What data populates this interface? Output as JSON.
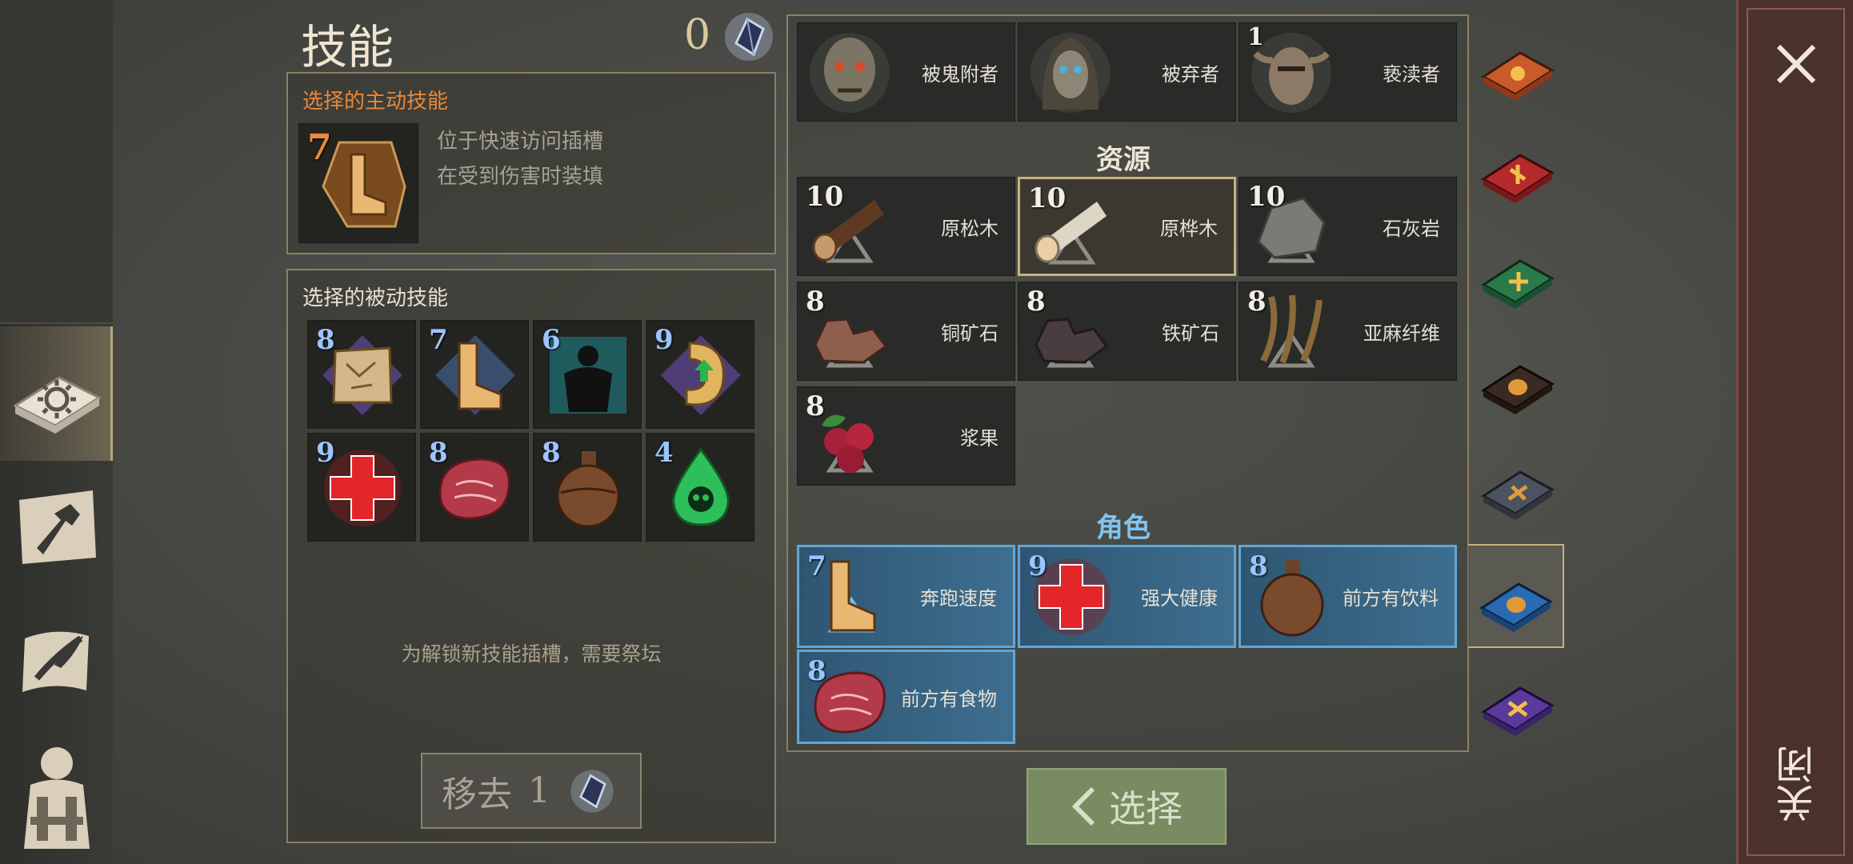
{
  "header": {
    "title": "技能",
    "currency_count": "0"
  },
  "active_skill": {
    "label": "选择的主动技能",
    "level": "7",
    "icon": "running-leg-icon",
    "desc_line1": "位于快速访问插槽",
    "desc_line2": "在受到伤害时装填"
  },
  "passive": {
    "label": "选择的被动技能",
    "slots": [
      {
        "level": "8",
        "icon": "map-scroll-icon"
      },
      {
        "level": "7",
        "icon": "running-leg-icon"
      },
      {
        "level": "6",
        "icon": "glowing-body-icon"
      },
      {
        "level": "9",
        "icon": "stomach-arrow-icon"
      },
      {
        "level": "9",
        "icon": "red-cross-icon"
      },
      {
        "level": "8",
        "icon": "steak-icon"
      },
      {
        "level": "8",
        "icon": "flask-icon"
      },
      {
        "level": "4",
        "icon": "poison-drop-icon"
      }
    ],
    "unlock_hint": "为解锁新技能插槽，需要祭坛",
    "remove_label": "移去",
    "remove_cost": "1"
  },
  "enemies": [
    {
      "name": "被鬼附者",
      "icon": "zombie-head-icon"
    },
    {
      "name": "被弃者",
      "icon": "hooded-ghoul-icon"
    },
    {
      "name": "亵渎者",
      "icon": "horned-skull-icon",
      "level": "1"
    }
  ],
  "resources": {
    "label": "资源",
    "items": [
      {
        "level": "10",
        "name": "原松木",
        "icon": "pine-log-icon"
      },
      {
        "level": "10",
        "name": "原桦木",
        "icon": "birch-log-icon"
      },
      {
        "level": "10",
        "name": "石灰岩",
        "icon": "limestone-icon"
      },
      {
        "level": "8",
        "name": "铜矿石",
        "icon": "copper-ore-icon"
      },
      {
        "level": "8",
        "name": "铁矿石",
        "icon": "iron-ore-icon"
      },
      {
        "level": "8",
        "name": "亚麻纤维",
        "icon": "flax-fiber-icon"
      },
      {
        "level": "8",
        "name": "浆果",
        "icon": "berries-icon"
      }
    ]
  },
  "character": {
    "label": "角色",
    "items": [
      {
        "level": "7",
        "name": "奔跑速度",
        "icon": "running-leg-icon"
      },
      {
        "level": "9",
        "name": "强大健康",
        "icon": "red-cross-icon"
      },
      {
        "level": "8",
        "name": "前方有饮料",
        "icon": "flask-icon"
      },
      {
        "level": "8",
        "name": "前方有食物",
        "icon": "steak-icon"
      }
    ]
  },
  "select_button": "选择",
  "close_label": "关闭",
  "colors": {
    "accent_orange": "#e7883a",
    "blue_highlight": "#5fa7d9",
    "select_green": "#798b61",
    "close_panel": "#4b312b"
  }
}
